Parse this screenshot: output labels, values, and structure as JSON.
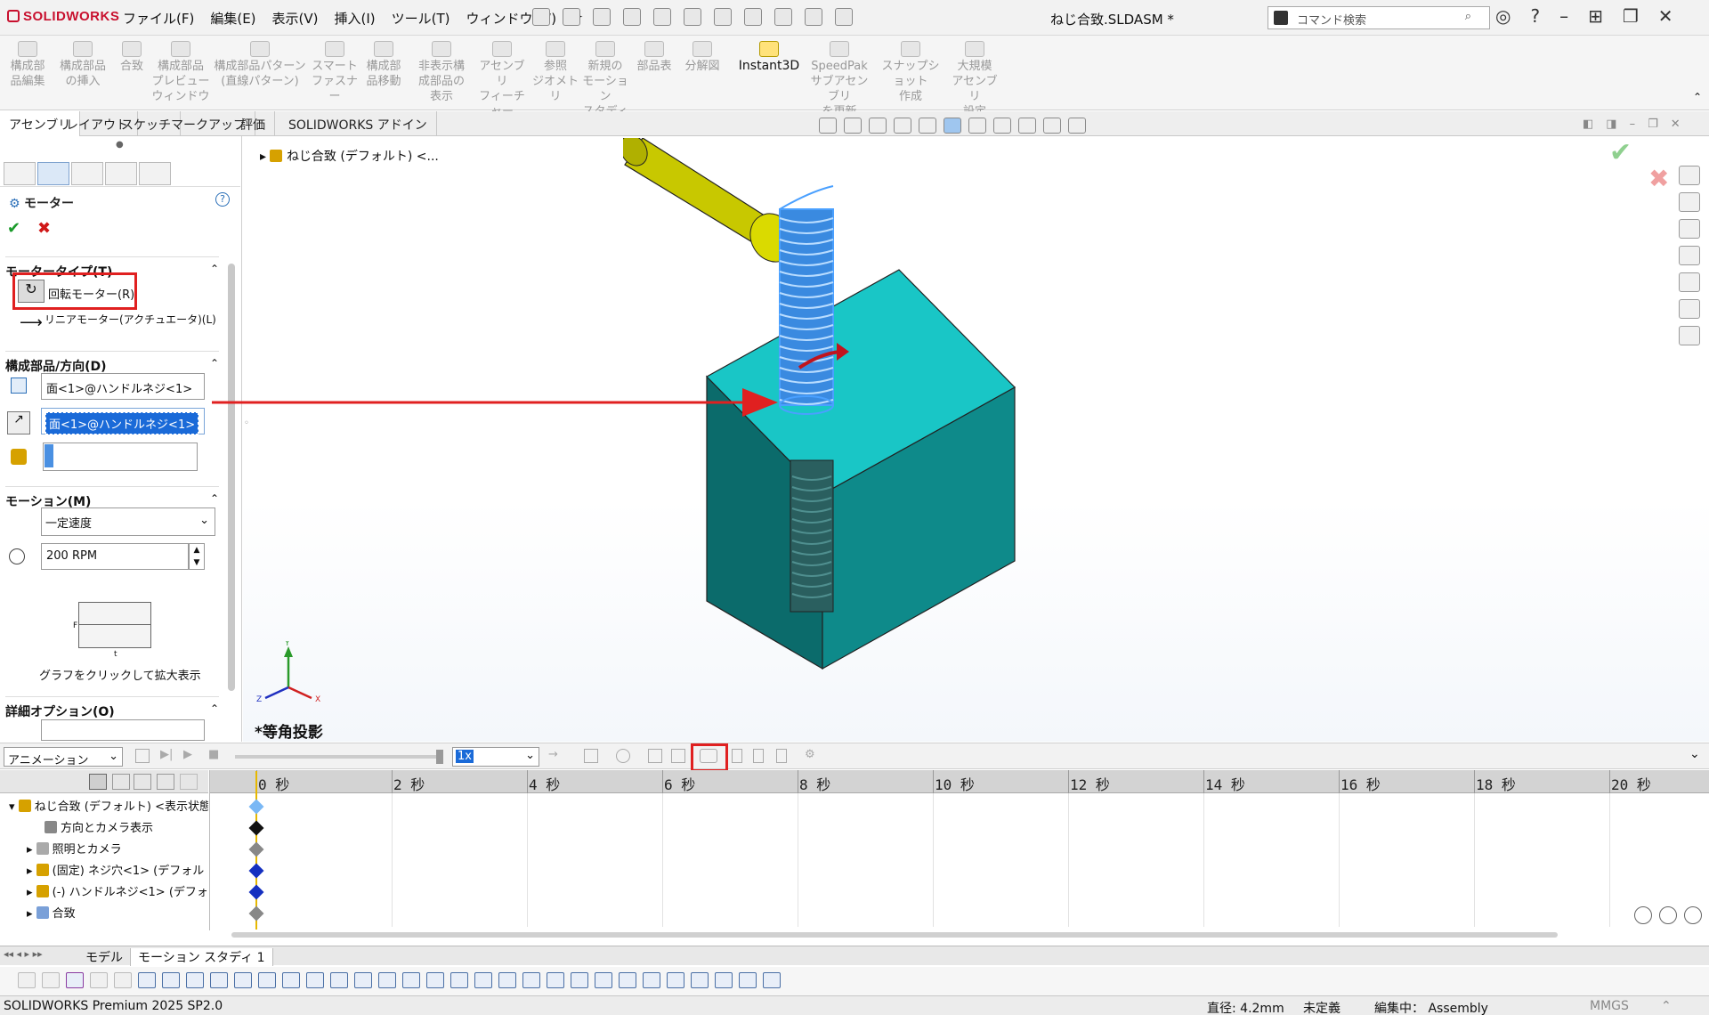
{
  "app": {
    "logo": "SOLIDWORKS",
    "document_title": "ねじ合致.SLDASM *"
  },
  "menu": [
    "ファイル(F)",
    "編集(E)",
    "表示(V)",
    "挿入(I)",
    "ツール(T)",
    "ウィンドウ(W)"
  ],
  "command_search": {
    "placeholder": "コマンド検索"
  },
  "ribbon": [
    {
      "label1": "構成部",
      "label2": "品編集"
    },
    {
      "label1": "構成部品",
      "label2": "の挿入"
    },
    {
      "label1": "合致",
      "label2": ""
    },
    {
      "label1": "構成部品",
      "label2": "プレビュー",
      "label3": "ウィンドウ"
    },
    {
      "label1": "構成部品パターン",
      "label2": "(直線パターン)"
    },
    {
      "label1": "スマート",
      "label2": "ファスナー"
    },
    {
      "label1": "構成部",
      "label2": "品移動"
    },
    {
      "label1": "非表示構",
      "label2": "成部品の",
      "label3": "表示"
    },
    {
      "label1": "アセンブリ",
      "label2": "フィーチャー"
    },
    {
      "label1": "参照",
      "label2": "ジオメトリ"
    },
    {
      "label1": "新規の",
      "label2": "モーション",
      "label3": "スタディ"
    },
    {
      "label1": "部品表",
      "label2": ""
    },
    {
      "label1": "分解図",
      "label2": ""
    },
    {
      "label1": "Instant3D",
      "label2": ""
    },
    {
      "label1": "SpeedPak",
      "label2": "サブアセンブリ",
      "label3": "を更新"
    },
    {
      "label1": "スナップショット",
      "label2": "作成"
    },
    {
      "label1": "大規模",
      "label2": "アセンブリ",
      "label3": "設定"
    }
  ],
  "tabs": [
    "アセンブリ",
    "レイアウト",
    "スケッチ",
    "マークアップ",
    "評価",
    "SOLIDWORKS アドイン"
  ],
  "property_manager": {
    "title": "モーター",
    "motor_type": {
      "header": "モータータイプ(T)",
      "rotary": "回転モーター(R)",
      "linear": "リニアモーター(アクチュエータ)(L)"
    },
    "component_direction": {
      "header": "構成部品/方向(D)",
      "location_value": "面<1>@ハンドルネジ<1>",
      "direction_value": "面<1>@ハンドルネジ<1>"
    },
    "motion": {
      "header": "モーション(M)",
      "type_value": "一定速度",
      "speed_value": "200 RPM",
      "graph_f": "F",
      "graph_t": "t",
      "graph_hint": "グラフをクリックして拡大表示"
    },
    "advanced": {
      "header": "詳細オプション(O)"
    }
  },
  "viewport": {
    "tree_head": "ねじ合致 (デフォルト) <...",
    "view_label": "*等角投影",
    "triad": {
      "x": "X",
      "y": "Y",
      "z": "Z"
    }
  },
  "motion_study": {
    "study_type": "アニメーション",
    "playback_speed": "1x",
    "ticks": [
      "0 秒",
      "2 秒",
      "4 秒",
      "6 秒",
      "8 秒",
      "10 秒",
      "12 秒",
      "14 秒",
      "16 秒",
      "18 秒",
      "20 秒"
    ],
    "tree": [
      "ねじ合致 (デフォルト) <表示状態",
      "方向とカメラ表示",
      "照明とカメラ",
      "(固定) ネジ穴<1> (デフォル",
      "(-) ハンドルネジ<1> (デフォ",
      "合致"
    ]
  },
  "bottom_tabs": {
    "model": "モデル",
    "motion": "モーション スタディ 1"
  },
  "status": {
    "product": "SOLIDWORKS Premium 2025 SP2.0",
    "diameter": "直径: 4.2mm",
    "state": "未定義",
    "editing": "編集中： Assembly",
    "units": "MMGS"
  },
  "colors": {
    "accent_red": "#e02020",
    "selection_blue": "#1a6ad8",
    "block_teal": "#19c6c6",
    "handle_yellow": "#c8c800"
  }
}
